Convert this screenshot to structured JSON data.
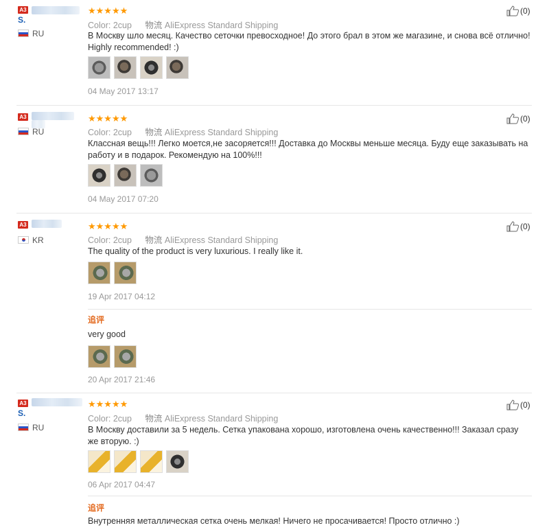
{
  "reviews": [
    {
      "badge": "A3",
      "initial": "S.",
      "country": "RU",
      "flag": "ru",
      "color_label": "Color:",
      "color_value": "2cup",
      "shipping_icon": "物流",
      "shipping": "AliExpress Standard Shipping",
      "text": "В Москву шло месяц. Качество сеточки превосходное! До этого брал в этом же магазине, и снова всё отлично! Highly recommended! :)",
      "photo_count": 4,
      "date": "04 May 2017 13:17",
      "likes": "(0)"
    },
    {
      "badge": "A3",
      "initial": "",
      "country": "RU",
      "flag": "ru",
      "color_label": "Color:",
      "color_value": "2cup",
      "shipping_icon": "物流",
      "shipping": "AliExpress Standard Shipping",
      "text": "Классная вещь!!! Легко моется,не засоряется!!! Доставка до Москвы меньше месяца. Буду еще заказывать на работу и в подарок. Рекомендую на 100%!!!",
      "photo_count": 3,
      "date": "04 May 2017 07:20",
      "likes": "(0)"
    },
    {
      "badge": "A3",
      "initial": "",
      "country": "KR",
      "flag": "kr",
      "color_label": "Color:",
      "color_value": "2cup",
      "shipping_icon": "物流",
      "shipping": "AliExpress Standard Shipping",
      "text": "The quality of the product is very luxurious. I really like it.",
      "photo_count": 2,
      "date": "19 Apr 2017 04:12",
      "likes": "(0)",
      "followup": {
        "label": "追评",
        "text": "very good",
        "photo_count": 2,
        "date": "20 Apr 2017 21:46"
      }
    },
    {
      "badge": "A3",
      "initial": "S.",
      "country": "RU",
      "flag": "ru",
      "color_label": "Color:",
      "color_value": "2cup",
      "shipping_icon": "物流",
      "shipping": "AliExpress Standard Shipping",
      "text": "В Москву доставили за 5 недель. Сетка упакована хорошо, изготовлена очень качественно!!! Заказал сразу же вторую. :)",
      "photo_count": 4,
      "date": "06 Apr 2017 04:47",
      "likes": "(0)",
      "followup": {
        "label": "追评",
        "text": "Внутренняя металлическая сетка очень мелкая! Ничего не просачивается! Просто отлично :)"
      }
    }
  ],
  "icons": {
    "like": "thumbs-up-icon",
    "rating": "five-star-rating"
  },
  "colors": {
    "star": "#ff9900",
    "append": "#e36a1f",
    "badge": "#d42b1e",
    "link": "#1a5eb4"
  }
}
